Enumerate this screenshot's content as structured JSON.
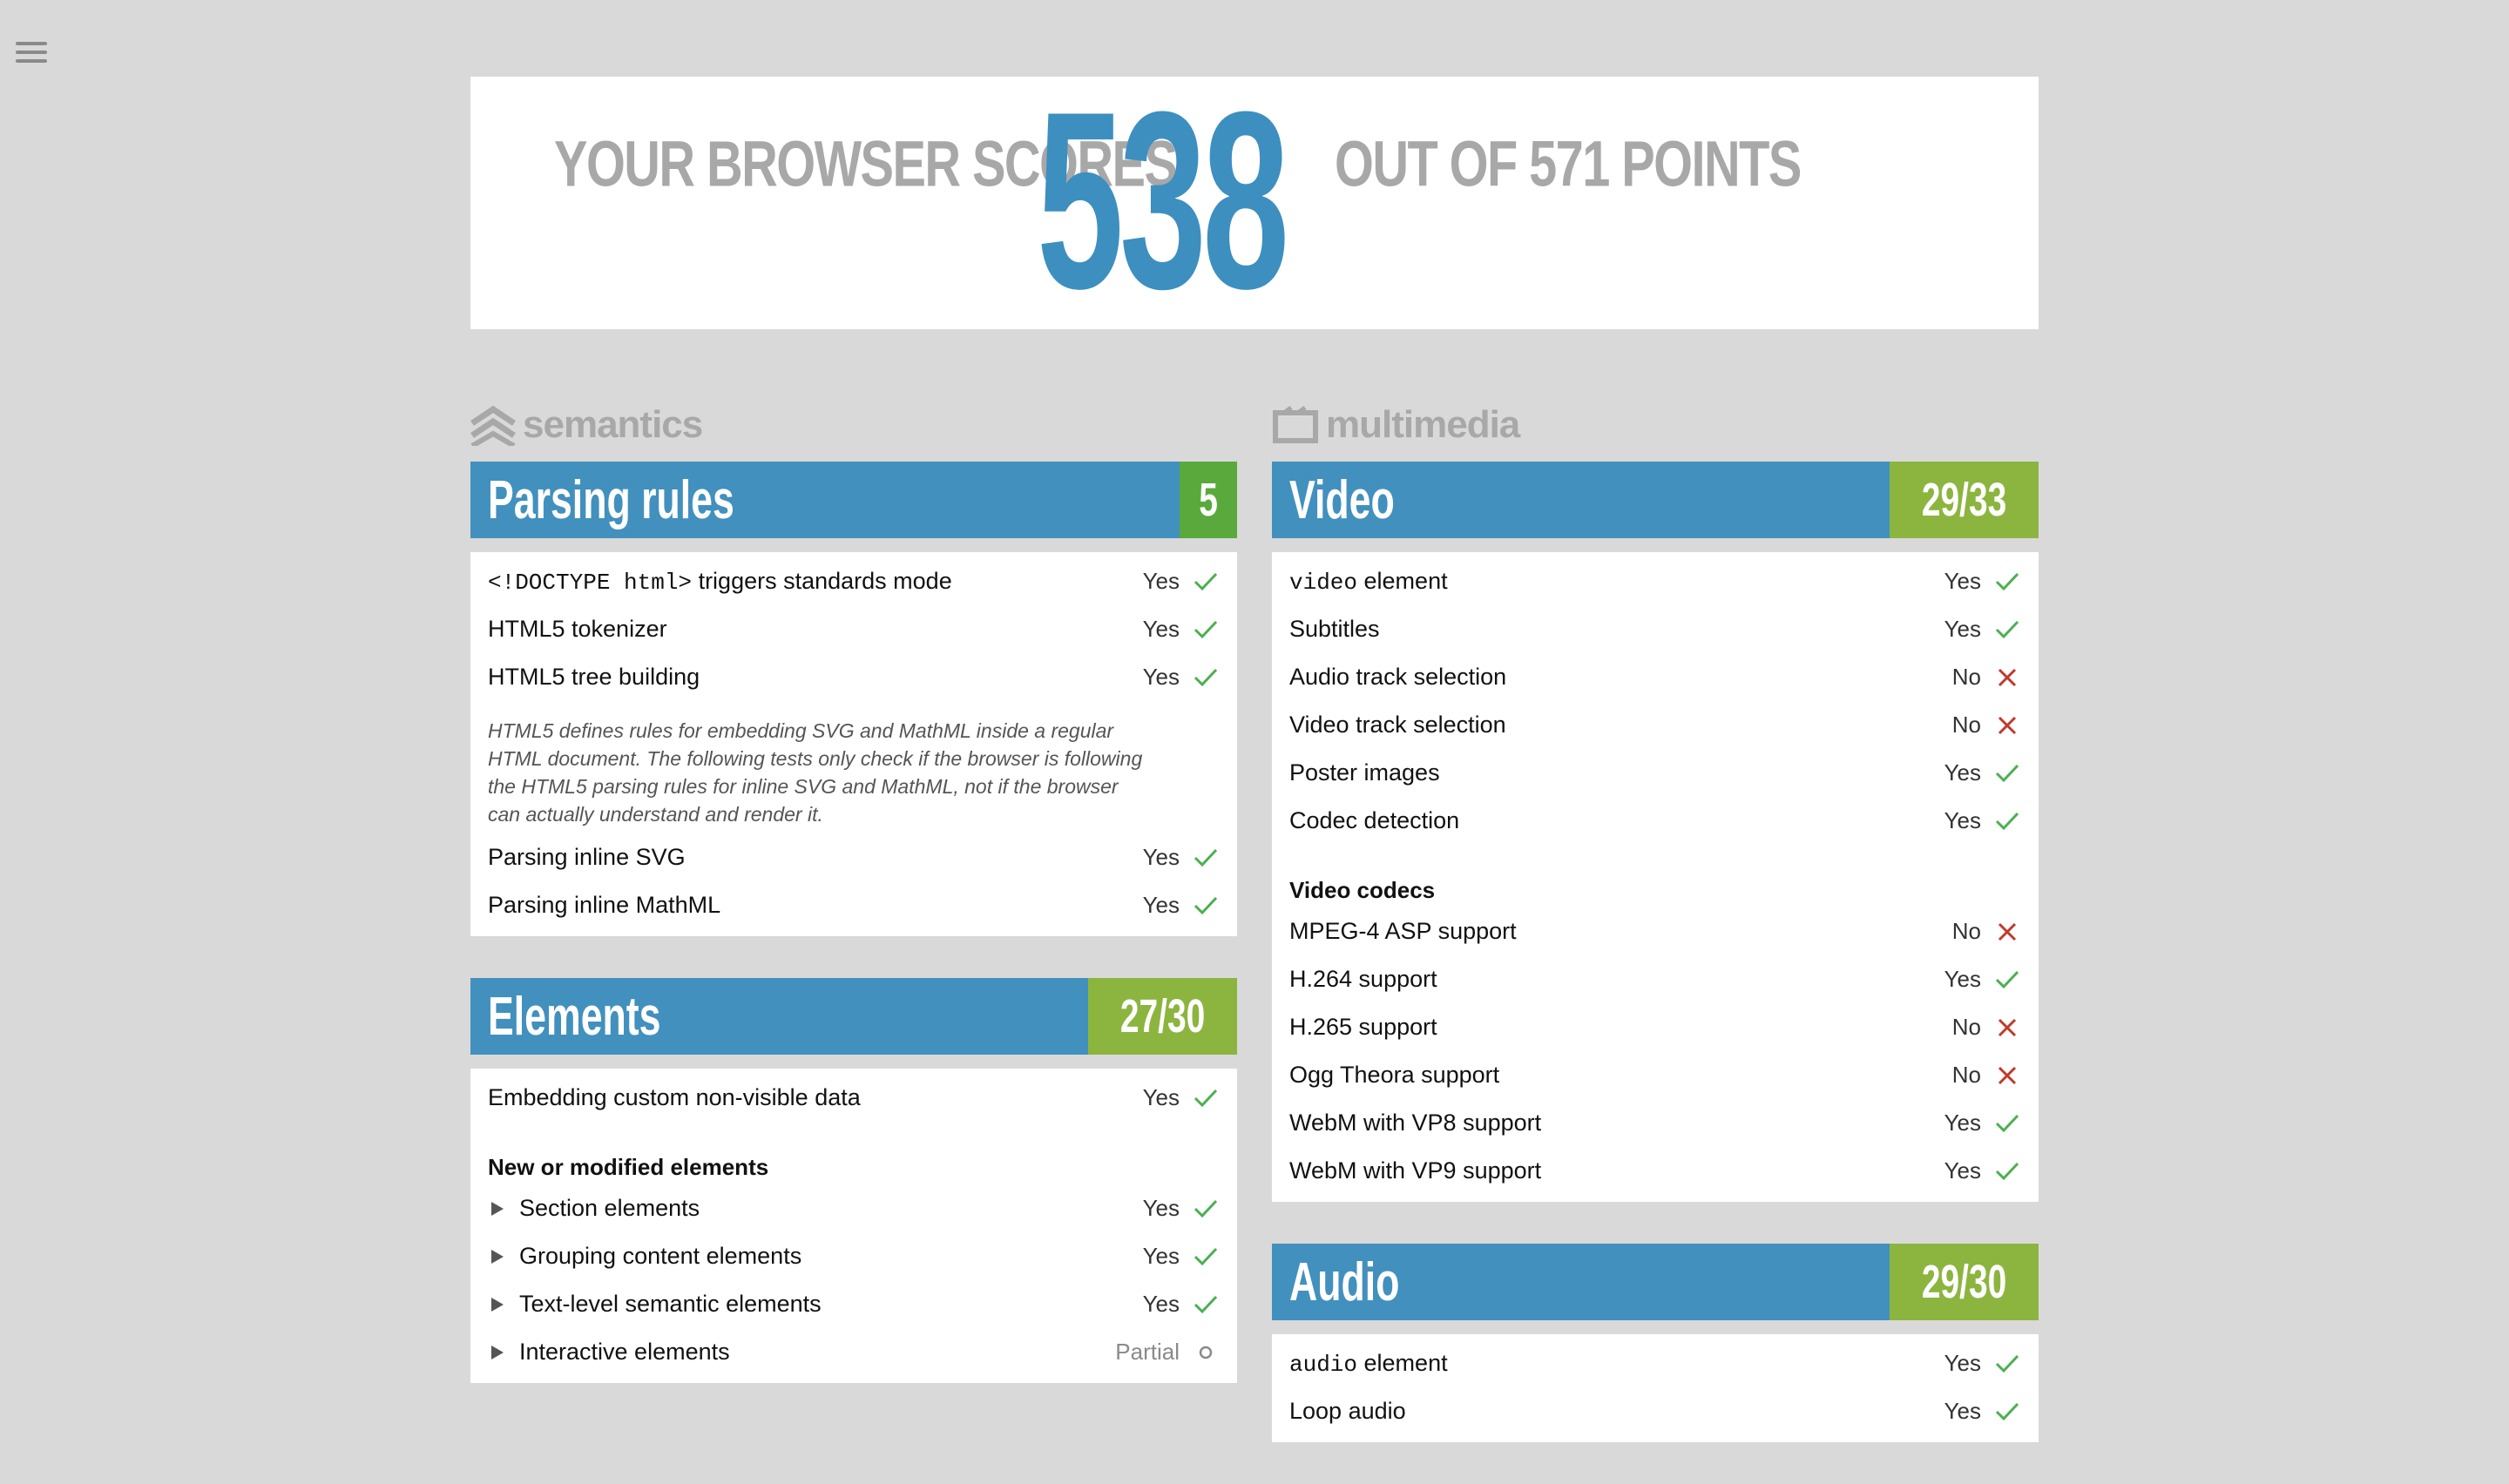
{
  "header": {
    "lead": "YOUR BROWSER SCORES",
    "score": "538",
    "tail": "OUT OF 571 POINTS"
  },
  "left": {
    "category": "semantics",
    "sections": [
      {
        "name": "Parsing rules",
        "score": "5",
        "full": true,
        "rows": [
          {
            "type": "row",
            "code": "<!DOCTYPE html>",
            "label": "triggers standards mode",
            "result": "Yes",
            "mark": "check"
          },
          {
            "type": "row",
            "label": "HTML5 tokenizer",
            "result": "Yes",
            "mark": "check"
          },
          {
            "type": "row",
            "label": "HTML5 tree building",
            "result": "Yes",
            "mark": "check"
          },
          {
            "type": "note",
            "text": "HTML5 defines rules for embedding SVG and MathML inside a regular HTML document. The following tests only check if the browser is following the HTML5 parsing rules for inline SVG and MathML, not if the browser can actually understand and render it."
          },
          {
            "type": "row",
            "label": "Parsing inline SVG",
            "result": "Yes",
            "mark": "check"
          },
          {
            "type": "row",
            "label": "Parsing inline MathML",
            "result": "Yes",
            "mark": "check"
          }
        ]
      },
      {
        "name": "Elements",
        "score": "27/30",
        "full": false,
        "rows": [
          {
            "type": "row",
            "label": "Embedding custom non-visible data",
            "result": "Yes",
            "mark": "check"
          },
          {
            "type": "group",
            "label": "New or modified elements"
          },
          {
            "type": "expand",
            "label": "Section elements",
            "result": "Yes",
            "mark": "check"
          },
          {
            "type": "expand",
            "label": "Grouping content elements",
            "result": "Yes",
            "mark": "check"
          },
          {
            "type": "expand",
            "label": "Text-level semantic elements",
            "result": "Yes",
            "mark": "check"
          },
          {
            "type": "expand",
            "label": "Interactive elements",
            "result": "Partial",
            "mark": "circle"
          }
        ]
      }
    ]
  },
  "right": {
    "category": "multimedia",
    "sections": [
      {
        "name": "Video",
        "score": "29/33",
        "full": false,
        "rows": [
          {
            "type": "row",
            "code": "video",
            "label": "element",
            "result": "Yes",
            "mark": "check"
          },
          {
            "type": "row",
            "label": "Subtitles",
            "result": "Yes",
            "mark": "check"
          },
          {
            "type": "row",
            "label": "Audio track selection",
            "result": "No",
            "mark": "cross"
          },
          {
            "type": "row",
            "label": "Video track selection",
            "result": "No",
            "mark": "cross"
          },
          {
            "type": "row",
            "label": "Poster images",
            "result": "Yes",
            "mark": "check"
          },
          {
            "type": "row",
            "label": "Codec detection",
            "result": "Yes",
            "mark": "check"
          },
          {
            "type": "group",
            "label": "Video codecs"
          },
          {
            "type": "row",
            "label": "MPEG-4 ASP support",
            "result": "No",
            "mark": "cross"
          },
          {
            "type": "row",
            "label": "H.264 support",
            "result": "Yes",
            "mark": "check"
          },
          {
            "type": "row",
            "label": "H.265 support",
            "result": "No",
            "mark": "cross"
          },
          {
            "type": "row",
            "label": "Ogg Theora support",
            "result": "No",
            "mark": "cross"
          },
          {
            "type": "row",
            "label": "WebM with VP8 support",
            "result": "Yes",
            "mark": "check"
          },
          {
            "type": "row",
            "label": "WebM with VP9 support",
            "result": "Yes",
            "mark": "check"
          }
        ]
      },
      {
        "name": "Audio",
        "score": "29/30",
        "full": false,
        "rows": [
          {
            "type": "row",
            "code": "audio",
            "label": "element",
            "result": "Yes",
            "mark": "check"
          },
          {
            "type": "row",
            "label": "Loop audio",
            "result": "Yes",
            "mark": "check"
          }
        ]
      }
    ]
  },
  "colors": {
    "blue": "#4290be",
    "green_partial": "#8cb53f",
    "green_full": "#5aa93c",
    "check": "#4caf50",
    "cross": "#c0392b"
  }
}
